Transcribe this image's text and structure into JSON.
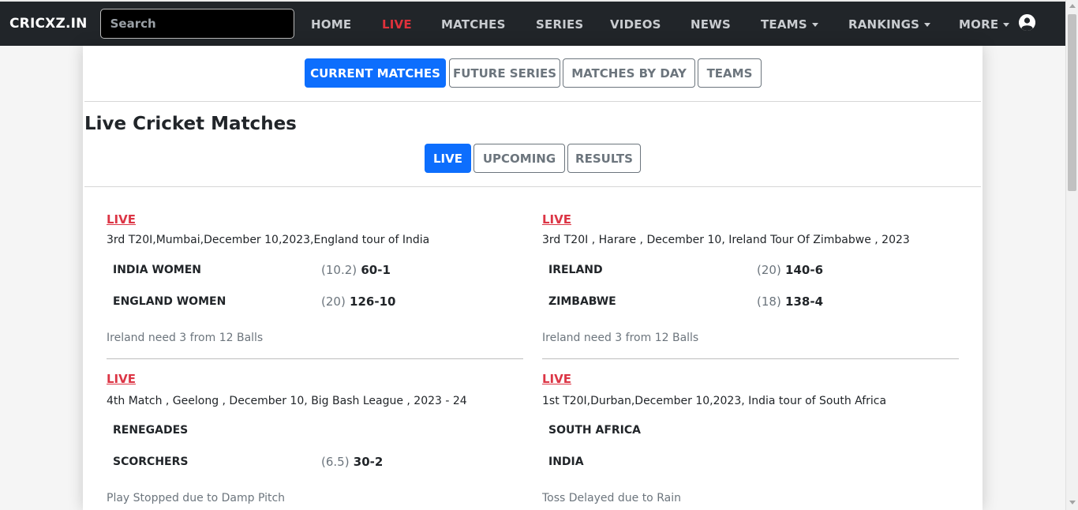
{
  "nav": {
    "brand": "CRICXZ.IN",
    "search_placeholder": "Search",
    "items": [
      {
        "label": "HOME"
      },
      {
        "label": "LIVE"
      },
      {
        "label": "MATCHES"
      },
      {
        "label": "SERIES"
      },
      {
        "label": "VIDEOS"
      },
      {
        "label": "NEWS"
      },
      {
        "label": "TEAMS"
      },
      {
        "label": "RANKINGS"
      },
      {
        "label": "MORE"
      }
    ],
    "active_color": "#e0313b"
  },
  "tabs": [
    "CURRENT MATCHES",
    "FUTURE SERIES",
    "MATCHES BY DAY",
    "TEAMS"
  ],
  "title": "Live Cricket Matches",
  "subtabs": [
    "LIVE",
    "UPCOMING",
    "RESULTS"
  ],
  "matches": [
    {
      "tag": "LIVE",
      "desc": "3rd T20I,Mumbai,December 10,2023,England tour of India",
      "teams": [
        {
          "name": "INDIA WOMEN",
          "overs": "(10.2)",
          "score": "60-1"
        },
        {
          "name": "ENGLAND WOMEN",
          "overs": "(20)",
          "score": "126-10"
        }
      ],
      "status": "Ireland need 3 from 12 Balls"
    },
    {
      "tag": "LIVE",
      "desc": "3rd T20I , Harare , December 10, Ireland Tour Of Zimbabwe , 2023",
      "teams": [
        {
          "name": "IRELAND",
          "overs": "(20)",
          "score": "140-6"
        },
        {
          "name": "ZIMBABWE",
          "overs": "(18)",
          "score": "138-4"
        }
      ],
      "status": "Ireland need 3 from 12 Balls"
    },
    {
      "tag": "LIVE",
      "desc": "4th Match , Geelong , December 10, Big Bash League , 2023 - 24",
      "teams": [
        {
          "name": "RENEGADES",
          "overs": "",
          "score": ""
        },
        {
          "name": "SCORCHERS",
          "overs": "(6.5)",
          "score": "30-2"
        }
      ],
      "status": "Play Stopped due to Damp Pitch"
    },
    {
      "tag": "LIVE",
      "desc": "1st T20I,Durban,December 10,2023, India tour of South Africa",
      "teams": [
        {
          "name": "SOUTH AFRICA",
          "overs": "",
          "score": ""
        },
        {
          "name": "INDIA",
          "overs": "",
          "score": ""
        }
      ],
      "status": "Toss Delayed due to Rain"
    }
  ],
  "colors": {
    "primary": "#0d6efd",
    "live": "#dc3545",
    "navbar": "#212529"
  }
}
